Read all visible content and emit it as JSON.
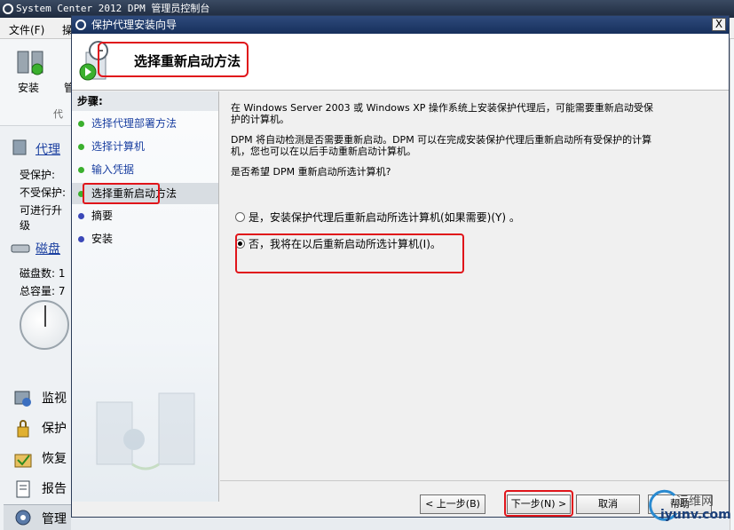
{
  "console": {
    "title": "System Center 2012 DPM 管理员控制台",
    "menu": [
      "文件(F)",
      "操"
    ],
    "ribbon": {
      "install_label": "安装",
      "second_label": "管",
      "group_label": "代"
    },
    "sidebar": {
      "agents_link": "代理",
      "protected": "受保护:",
      "unprotected": "不受保护:",
      "upgradable": "可进行升级",
      "disks_link": "磁盘",
      "disk_count": "磁盘数: 1",
      "total_capacity": "总容量: 7",
      "nav": [
        "监视",
        "保护",
        "恢复",
        "报告",
        "管理"
      ]
    }
  },
  "wizard": {
    "title": "保护代理安装向导",
    "close_label": "X",
    "header_title": "选择重新启动方法",
    "steps_heading": "步骤:",
    "steps": [
      {
        "label": "选择代理部署方法",
        "state": "done"
      },
      {
        "label": "选择计算机",
        "state": "done"
      },
      {
        "label": "输入凭据",
        "state": "done"
      },
      {
        "label": "选择重新启动方法",
        "state": "current"
      },
      {
        "label": "摘要",
        "state": "todo"
      },
      {
        "label": "安装",
        "state": "todo"
      }
    ],
    "para1_line1": "在 Windows Server 2003 或 Windows XP 操作系统上安装保护代理后，可能需要重新启动受保",
    "para1_line2": "护的计算机。",
    "para2_line1": "DPM 将自动检测是否需要重新启动。DPM 可以在完成安装保护代理后重新启动所有受保护的计算",
    "para2_line2": "机，您也可以在以后手动重新启动计算机。",
    "question": "是否希望 DPM 重新启动所选计算机?",
    "options": [
      {
        "label": "是，安装保护代理后重新启动所选计算机(如果需要)(Y) 。",
        "selected": false
      },
      {
        "label": "否，我将在以后重新启动所选计算机(I)。",
        "selected": true
      }
    ],
    "buttons": {
      "back": "< 上一步(B)",
      "next": "下一步(N) >",
      "cancel": "取消",
      "help": "帮助"
    }
  },
  "watermark": {
    "line1": "运维网",
    "line2": "iyunv.com"
  }
}
